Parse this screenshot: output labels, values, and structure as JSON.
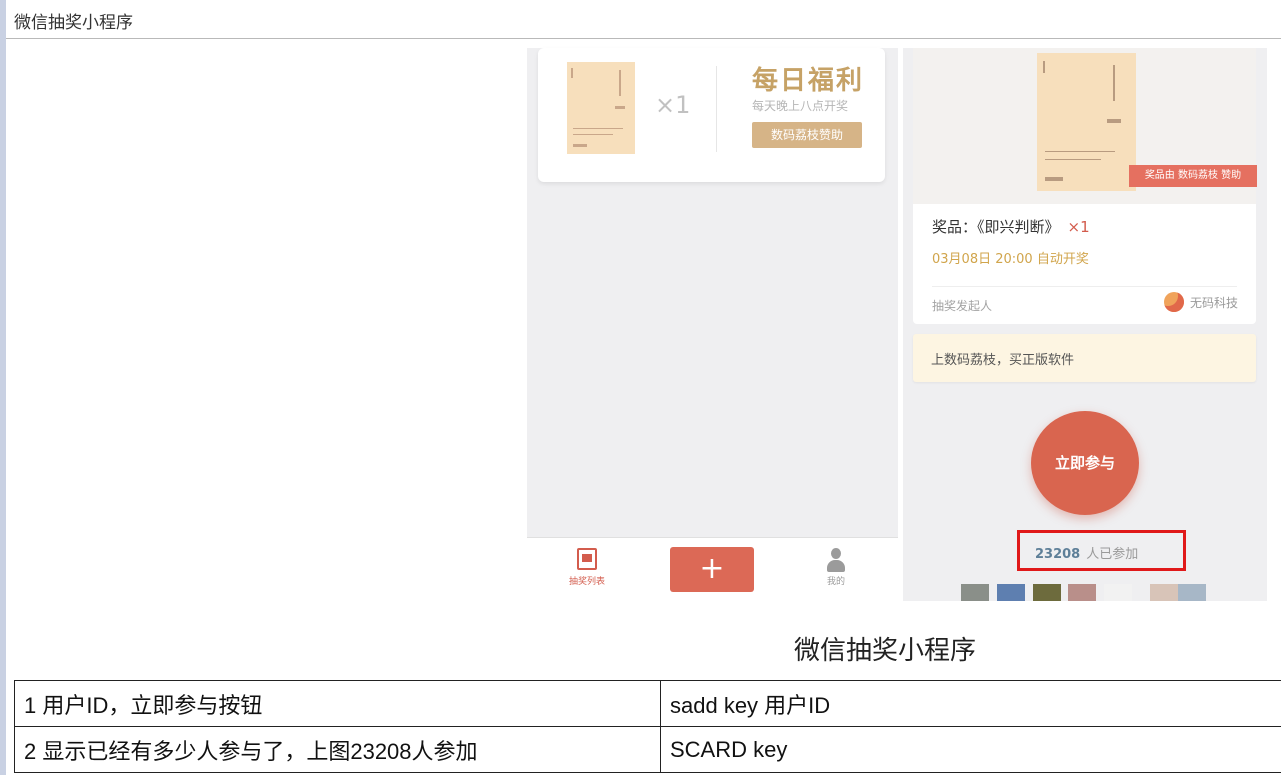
{
  "window": {
    "title": "微信抽奖小程序"
  },
  "list_page": {
    "prize_card": {
      "quantity": "×1",
      "daily_title": "每日福利",
      "daily_subtitle": "每天晚上八点开奖",
      "sponsor_button": "数码荔枝赞助"
    },
    "tabbar": {
      "tabs": [
        {
          "label": "抽奖列表",
          "icon": "list-icon",
          "active": true
        },
        {
          "label": "+",
          "icon": "plus-icon"
        },
        {
          "label": "我的",
          "icon": "user-icon"
        }
      ]
    }
  },
  "detail_page": {
    "sponsor_tag": "奖品由 数码荔枝 赞助",
    "prize_label": "奖品：《即兴判断》",
    "prize_qty": "×1",
    "draw_time": "03月08日 20:00 自动开奖",
    "initiator_label": "抽奖发起人",
    "organizer_name": "无码科技",
    "notice": "上数码荔枝，买正版软件",
    "join_button": "立即参与",
    "participant_count": "23208",
    "participant_suffix": "人已参加"
  },
  "caption": "微信抽奖小程序",
  "table": {
    "rows": [
      [
        "1 用户ID，立即参与按钮",
        "sadd key 用户ID"
      ],
      [
        "2 显示已经有多少人参与了，上图23208人参加",
        "SCARD key"
      ]
    ]
  },
  "colors": {
    "accent": "#dc6956",
    "gold": "#c6a266",
    "highlight_border": "#e0191a"
  }
}
